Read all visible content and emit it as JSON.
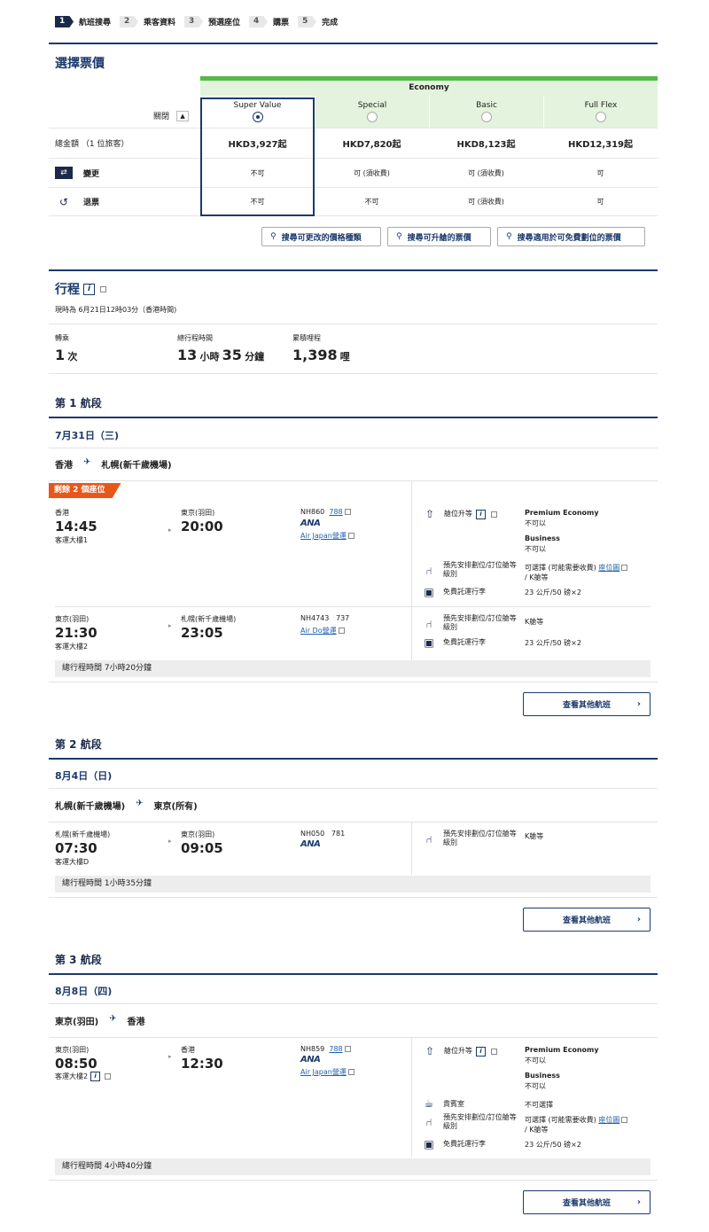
{
  "steps": [
    {
      "n": "1",
      "label": "航班搜尋"
    },
    {
      "n": "2",
      "label": "乘客資料"
    },
    {
      "n": "3",
      "label": "預選座位"
    },
    {
      "n": "4",
      "label": "購票"
    },
    {
      "n": "5",
      "label": "完成"
    }
  ],
  "fare": {
    "title": "選擇票價",
    "cabin": "Economy",
    "collapse_label": "關閉",
    "columns": [
      "Super Value",
      "Special",
      "Basic",
      "Full Flex"
    ],
    "total_label": "總金額 （1 位旅客）",
    "prices": [
      "HKD3,927起",
      "HKD7,820起",
      "HKD8,123起",
      "HKD12,319起"
    ],
    "change_label": "變更",
    "change": [
      "不可",
      "可 (須收費)",
      "可 (須收費)",
      "可"
    ],
    "refund_label": "退票",
    "refund": [
      "不可",
      "不可",
      "可 (須收費)",
      "可"
    ],
    "buttons": [
      "搜尋可更改的價格種類",
      "搜尋可升艙的票價",
      "搜尋適用於可免費劃位的票價"
    ]
  },
  "itinerary": {
    "title": "行程",
    "now": "現時為 6月21日12時03分（香港時間)",
    "transfer_label": "轉乘",
    "transfer_val": "1",
    "transfer_unit": "次",
    "duration_label": "總行程時間",
    "dur_h": "13",
    "dur_h_unit": "小時",
    "dur_m": "35",
    "dur_m_unit": "分鐘",
    "miles_label": "累積哩程",
    "miles": "1,398",
    "miles_unit": "哩"
  },
  "seg1": {
    "title": "第 1 航段",
    "date": "7月31日（三)",
    "route_from": "香港",
    "route_to": "札幌(新千歲機場)",
    "remaining": "剩餘 2 個座位",
    "f1": {
      "dep_city": "香港",
      "dep_time": "14:45",
      "dep_term": "客運大樓1",
      "arr_city": "東京(羽田)",
      "arr_time": "20:00",
      "flight": "NH860",
      "aircraft": "788",
      "airline": "ANA",
      "operator": "Air Japan營運",
      "upgrade_label": "艙位升等",
      "pe_label": "Premium Economy",
      "pe_val": "不可以",
      "biz_label": "Business",
      "biz_val": "不可以",
      "seat_label": "預先安排劃位/訂位艙等級別",
      "seat_val": "可選擇 (可能需要收費)",
      "seat_link": "座位圖",
      "seat_class": "/ K艙等",
      "bag_label": "免費託運行李",
      "bag_val": "23 公斤/50 磅×2"
    },
    "f2": {
      "dep_city": "東京(羽田)",
      "dep_time": "21:30",
      "dep_term": "客運大樓2",
      "arr_city": "札幌(新千歲機場)",
      "arr_time": "23:05",
      "flight": "NH4743",
      "aircraft": "737",
      "operator": "Air Do營運",
      "seat_label": "預先安排劃位/訂位艙等級別",
      "seat_val": "K艙等",
      "bag_label": "免費託運行李",
      "bag_val": "23 公斤/50 磅×2"
    },
    "total": "總行程時間 7小時20分鐘",
    "more": "查看其他航班"
  },
  "seg2": {
    "title": "第 2 航段",
    "date": "8月4日（日)",
    "route_from": "札幌(新千歲機場)",
    "route_to": "東京(所有)",
    "f1": {
      "dep_city": "札幌(新千歲機場)",
      "dep_time": "07:30",
      "dep_term": "客運大樓D",
      "arr_city": "東京(羽田)",
      "arr_time": "09:05",
      "flight": "NH050",
      "aircraft": "781",
      "airline": "ANA",
      "seat_label": "預先安排劃位/訂位艙等級別",
      "seat_val": "K艙等"
    },
    "total": "總行程時間 1小時35分鐘",
    "more": "查看其他航班"
  },
  "seg3": {
    "title": "第 3 航段",
    "date": "8月8日（四)",
    "route_from": "東京(羽田)",
    "route_to": "香港",
    "f1": {
      "dep_city": "東京(羽田)",
      "dep_time": "08:50",
      "dep_term": "客運大樓2",
      "arr_city": "香港",
      "arr_time": "12:30",
      "flight": "NH859",
      "aircraft": "788",
      "airline": "ANA",
      "operator": "Air Japan營運",
      "upgrade_label": "艙位升等",
      "pe_label": "Premium Economy",
      "pe_val": "不可以",
      "biz_label": "Business",
      "biz_val": "不可以",
      "lounge_label": "貴賓室",
      "lounge_val": "不可選擇",
      "seat_label": "預先安排劃位/訂位艙等級別",
      "seat_val": "可選擇 (可能需要收費)",
      "seat_link": "座位圖",
      "seat_class": "/ K艙等",
      "bag_label": "免費託運行李",
      "bag_val": "23 公斤/50 磅×2"
    },
    "total": "總行程時間 4小時40分鐘",
    "more": "查看其他航班"
  }
}
